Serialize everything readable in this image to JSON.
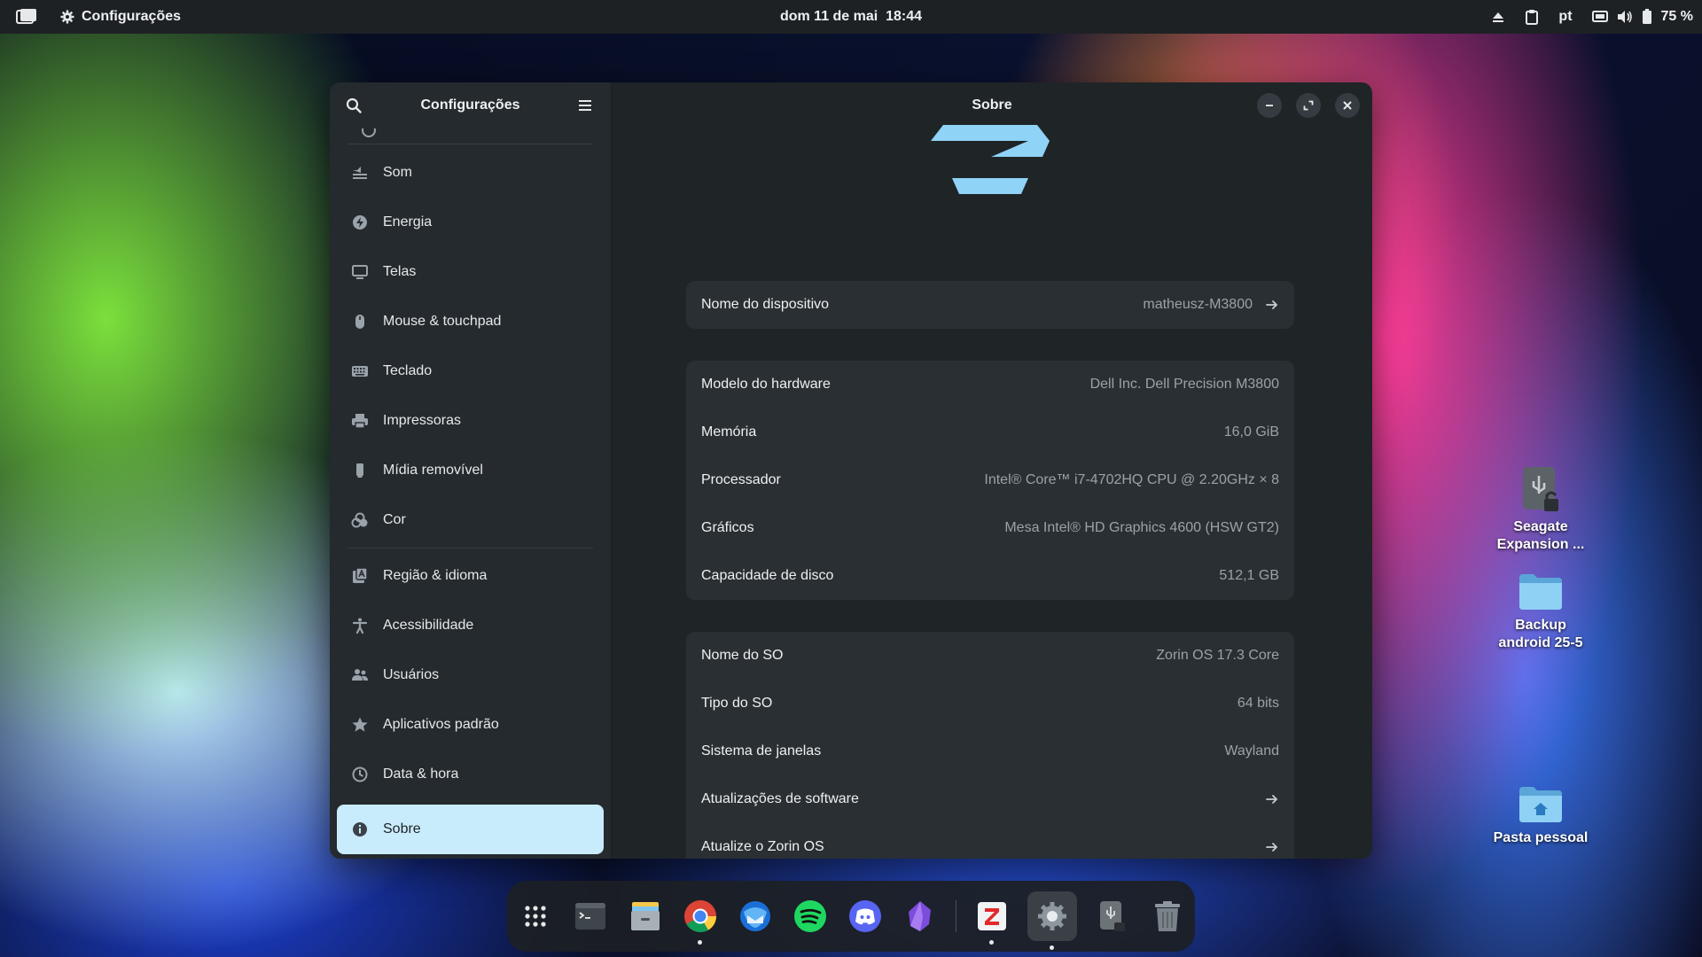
{
  "topbar": {
    "app_name": "Configurações",
    "clock": "dom 11 de mai  18:44",
    "language": "pt",
    "battery": "75 %"
  },
  "window": {
    "sidebar": {
      "title": "Configurações",
      "items": [
        {
          "label": "Som",
          "icon": "speaker-icon"
        },
        {
          "label": "Energia",
          "icon": "power-icon"
        },
        {
          "label": "Telas",
          "icon": "display-icon"
        },
        {
          "label": "Mouse & touchpad",
          "icon": "mouse-icon"
        },
        {
          "label": "Teclado",
          "icon": "keyboard-icon"
        },
        {
          "label": "Impressoras",
          "icon": "printer-icon"
        },
        {
          "label": "Mídia removível",
          "icon": "removable-media-icon"
        },
        {
          "label": "Cor",
          "icon": "color-icon"
        },
        {
          "label": "Região & idioma",
          "icon": "region-icon"
        },
        {
          "label": "Acessibilidade",
          "icon": "accessibility-icon"
        },
        {
          "label": "Usuários",
          "icon": "users-icon"
        },
        {
          "label": "Aplicativos padrão",
          "icon": "star-icon"
        },
        {
          "label": "Data & hora",
          "icon": "clock-icon"
        },
        {
          "label": "Sobre",
          "icon": "info-icon",
          "active": true
        }
      ]
    },
    "main": {
      "title": "Sobre",
      "device": {
        "label": "Nome do dispositivo",
        "value": "matheusz-M3800"
      },
      "hardware": [
        {
          "label": "Modelo do hardware",
          "value": "Dell Inc. Dell Precision M3800"
        },
        {
          "label": "Memória",
          "value": "16,0 GiB"
        },
        {
          "label": "Processador",
          "value": "Intel® Core™ i7-4702HQ CPU @ 2.20GHz × 8"
        },
        {
          "label": "Gráficos",
          "value": "Mesa Intel® HD Graphics 4600 (HSW GT2)"
        },
        {
          "label": "Capacidade de disco",
          "value": "512,1 GB"
        }
      ],
      "os": [
        {
          "label": "Nome do SO",
          "value": "Zorin OS 17.3 Core"
        },
        {
          "label": "Tipo do SO",
          "value": "64 bits"
        },
        {
          "label": "Sistema de janelas",
          "value": "Wayland"
        },
        {
          "label": "Atualizações de software",
          "value": ""
        },
        {
          "label": "Atualize o Zorin OS",
          "value": ""
        }
      ]
    }
  },
  "desktop_icons": [
    {
      "label_line1": "Seagate",
      "label_line2": "Expansion ..."
    },
    {
      "label_line1": "Backup",
      "label_line2": "android 25-5"
    },
    {
      "label_line1": "Pasta pessoal",
      "label_line2": ""
    }
  ],
  "colors": {
    "accent": "#c9ecfd",
    "zorin_logo": "#8fd3f7",
    "window_bg": "#1f2427",
    "sidebar_bg": "#252a2e"
  }
}
